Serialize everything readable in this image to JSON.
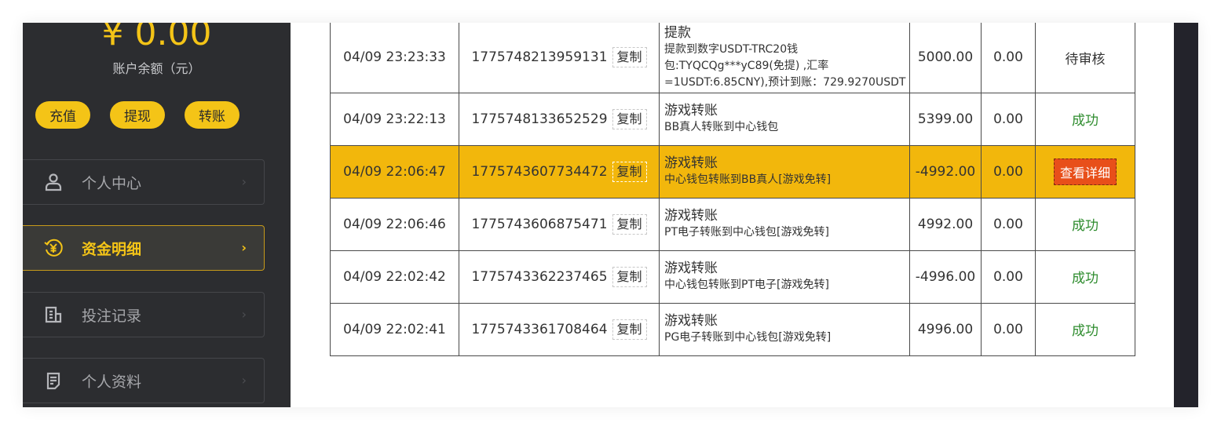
{
  "sidebar": {
    "balance": "¥ 0.00",
    "balance_label": "账户余额（元）",
    "actions": [
      {
        "label": "充值"
      },
      {
        "label": "提现"
      },
      {
        "label": "转账"
      }
    ],
    "nav": [
      {
        "label": "个人中心",
        "icon": "user-icon",
        "active": false
      },
      {
        "label": "资金明细",
        "icon": "yuan-circle-icon",
        "active": true
      },
      {
        "label": "投注记录",
        "icon": "bet-record-icon",
        "active": false
      },
      {
        "label": "个人资料",
        "icon": "profile-doc-icon",
        "active": false
      }
    ],
    "chevron": "›"
  },
  "colors": {
    "accent": "#f4c417",
    "sidebar_bg": "#2c2d30",
    "highlight_row": "#f2b70c",
    "success": "#2e8c2e",
    "detail_button": "#e84f1a"
  },
  "table": {
    "copy_label": "复制",
    "rows": [
      {
        "time": "04/09 23:23:33",
        "order_no": "1775748213959131",
        "title": "提款",
        "sub_lines": [
          "提款到数字USDT-TRC20钱",
          "包:TYQCQg***yC89(免提) ,汇率",
          "=1USDT:6.85CNY),预计到账：729.9270USDT"
        ],
        "amount": "5000.00",
        "fee": "0.00",
        "status": "待审核",
        "status_type": "pending"
      },
      {
        "time": "04/09 23:22:13",
        "order_no": "1775748133652529",
        "title": "游戏转账",
        "sub": "BB真人转账到中心钱包",
        "amount": "5399.00",
        "fee": "0.00",
        "status": "成功",
        "status_type": "success"
      },
      {
        "time": "04/09 22:06:47",
        "order_no": "1775743607734472",
        "title": "游戏转账",
        "sub": "中心钱包转账到BB真人[游戏免转]",
        "amount": "-4992.00",
        "fee": "0.00",
        "status": "查看详细",
        "status_type": "detail-button",
        "highlighted": true
      },
      {
        "time": "04/09 22:06:46",
        "order_no": "1775743606875471",
        "title": "游戏转账",
        "sub": "PT电子转账到中心钱包[游戏免转]",
        "amount": "4992.00",
        "fee": "0.00",
        "status": "成功",
        "status_type": "success"
      },
      {
        "time": "04/09 22:02:42",
        "order_no": "1775743362237465",
        "title": "游戏转账",
        "sub": "中心钱包转账到PT电子[游戏免转]",
        "amount": "-4996.00",
        "fee": "0.00",
        "status": "成功",
        "status_type": "success"
      },
      {
        "time": "04/09 22:02:41",
        "order_no": "1775743361708464",
        "title": "游戏转账",
        "sub": "PG电子转账到中心钱包[游戏免转]",
        "amount": "4996.00",
        "fee": "0.00",
        "status": "成功",
        "status_type": "success"
      }
    ]
  }
}
